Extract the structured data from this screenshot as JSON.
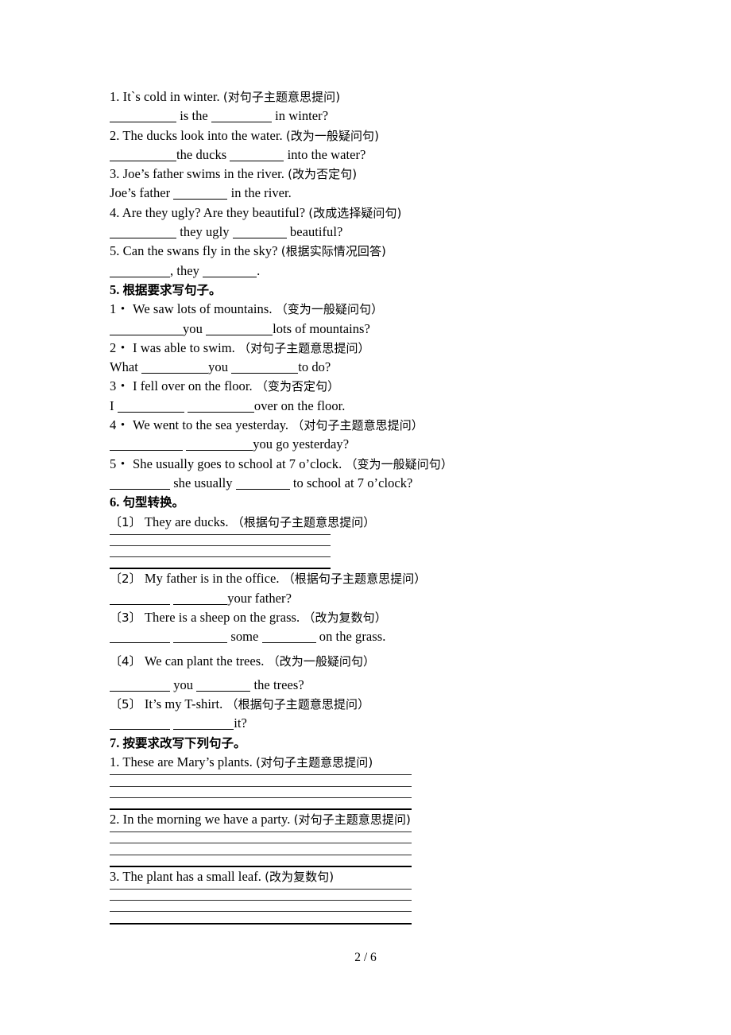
{
  "page": {
    "footer": "2 / 6"
  },
  "section4_continued": {
    "items": [
      {
        "prompt_number": "1.",
        "prompt_text": "It`s cold in winter.",
        "instruction": "(对句子主题意思提问)",
        "answer_prefix": "",
        "answer_parts": [
          "is the",
          "in winter?"
        ]
      },
      {
        "prompt_number": "2.",
        "prompt_text": "The ducks look into the water.",
        "instruction": "(改为一般疑问句)",
        "answer_prefix": "",
        "answer_parts": [
          "the ducks",
          "into the water?"
        ]
      },
      {
        "prompt_number": "3.",
        "prompt_text": "Joe’s father swims in the river.",
        "instruction": "(改为否定句)",
        "answer_prefix": "Joe’s father",
        "answer_parts": [
          "in the river."
        ]
      },
      {
        "prompt_number": "4.",
        "prompt_text": "Are they ugly? Are they beautiful?",
        "instruction": "(改成选择疑问句)",
        "answer_prefix": "",
        "answer_parts": [
          "they ugly",
          "beautiful?"
        ]
      },
      {
        "prompt_number": "5.",
        "prompt_text": "Can the swans fly in the sky?",
        "instruction": "(根据实际情况回答)",
        "answer_prefix": "",
        "answer_parts": [
          ", they",
          "."
        ]
      }
    ]
  },
  "section5": {
    "heading_number": "5.",
    "heading_text": "根据要求写句子。",
    "items": [
      {
        "prompt_number": "1・",
        "prompt_text": "We saw lots of mountains.",
        "instruction": "（变为一般疑问句）",
        "answer_prefix": "",
        "answer_parts": [
          "you",
          "lots of mountains?"
        ]
      },
      {
        "prompt_number": "2・",
        "prompt_text": "I was able to swim.",
        "instruction": "（对句子主题意思提问）",
        "answer_prefix": "What",
        "answer_parts": [
          "you",
          "to do?"
        ]
      },
      {
        "prompt_number": "3・",
        "prompt_text": "I fell over on the floor.",
        "instruction": "（变为否定句）",
        "answer_prefix": "I",
        "answer_parts": [
          "",
          "over on the floor."
        ]
      },
      {
        "prompt_number": "4・",
        "prompt_text": "We went to the sea yesterday.",
        "instruction": "（对句子主题意思提问）",
        "answer_prefix": "",
        "answer_parts": [
          "",
          "you go yesterday?"
        ]
      },
      {
        "prompt_number": "5・",
        "prompt_text": "She usually goes to school at 7 o’clock.",
        "instruction": "（变为一般疑问句）",
        "answer_prefix": "",
        "answer_parts": [
          "she usually",
          "to school at 7 o’clock?"
        ]
      }
    ]
  },
  "section6": {
    "heading_number": "6.",
    "heading_text": "句型转换。",
    "items": [
      {
        "prompt_number": "〔1〕",
        "prompt_text": "They are ducks.",
        "instruction": "（根据句子主题意思提问）",
        "answer_style": "rules",
        "rule_count": 4
      },
      {
        "prompt_number": "〔2〕",
        "prompt_text": "My father is in the office.",
        "instruction": "（根据句子主题意思提问）",
        "answer_style": "blanks",
        "answer_prefix": "",
        "answer_parts": [
          "",
          "your father?"
        ]
      },
      {
        "prompt_number": "〔3〕",
        "prompt_text": "There is a sheep on the grass.",
        "instruction": "（改为复数句）",
        "answer_style": "blanks",
        "answer_prefix": "",
        "answer_parts": [
          "",
          "some",
          "on the grass."
        ]
      },
      {
        "prompt_number": "〔4〕",
        "prompt_text": "We can plant the trees.",
        "instruction": "（改为一般疑问句）",
        "answer_style": "blanks",
        "answer_prefix": "",
        "answer_parts": [
          "you",
          "the trees?"
        ]
      },
      {
        "prompt_number": "〔5〕",
        "prompt_text": "It’s my T-shirt.",
        "instruction": "（根据句子主题意思提问）",
        "answer_style": "blanks",
        "answer_prefix": "",
        "answer_parts": [
          "",
          "it?"
        ]
      }
    ]
  },
  "section7": {
    "heading_number": "7.",
    "heading_text": "按要求改写下列句子。",
    "items": [
      {
        "prompt_number": "1.",
        "prompt_text": "These are Mary’s plants.",
        "instruction": "(对句子主题意思提问)",
        "rule_count": 4
      },
      {
        "prompt_number": "2.",
        "prompt_text": "In the morning we have a party.",
        "instruction": "(对句子主题意思提问)",
        "rule_count": 4
      },
      {
        "prompt_number": "3.",
        "prompt_text": "The plant has a small leaf.",
        "instruction": "(改为复数句)",
        "rule_count": 4
      }
    ]
  }
}
